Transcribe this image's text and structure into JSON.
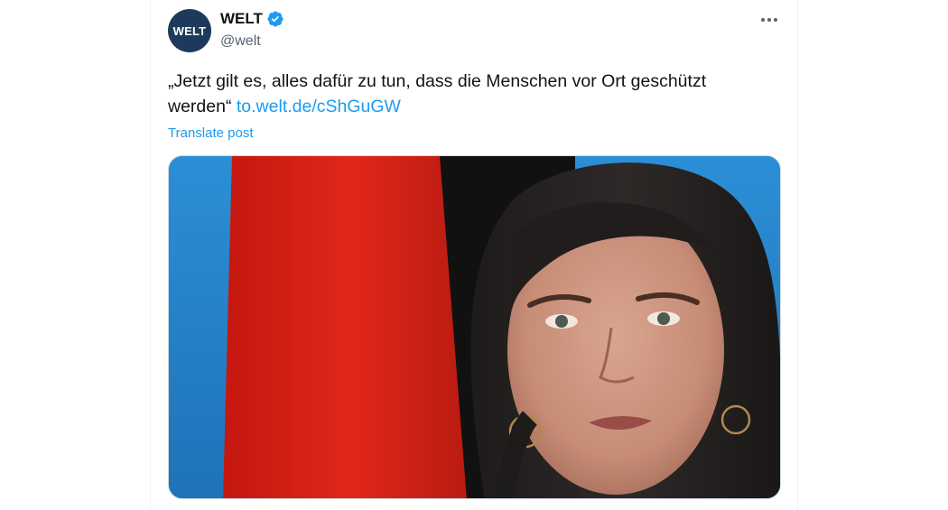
{
  "post": {
    "display_name": "WELT",
    "handle": "@welt",
    "avatar_text": "WELT",
    "verified_icon": "verified-badge-icon",
    "verified_color": "#1d9bf0",
    "more_icon": "more-horizontal-icon",
    "text": "„Jetzt gilt es, alles dafür zu tun, dass die Menschen vor Ort geschützt werden“",
    "link_text": "to.welt.de/cShGuGW",
    "translate_label": "Translate post",
    "link_color": "#1d9bf0",
    "avatar_color": "#1d3a5c"
  }
}
